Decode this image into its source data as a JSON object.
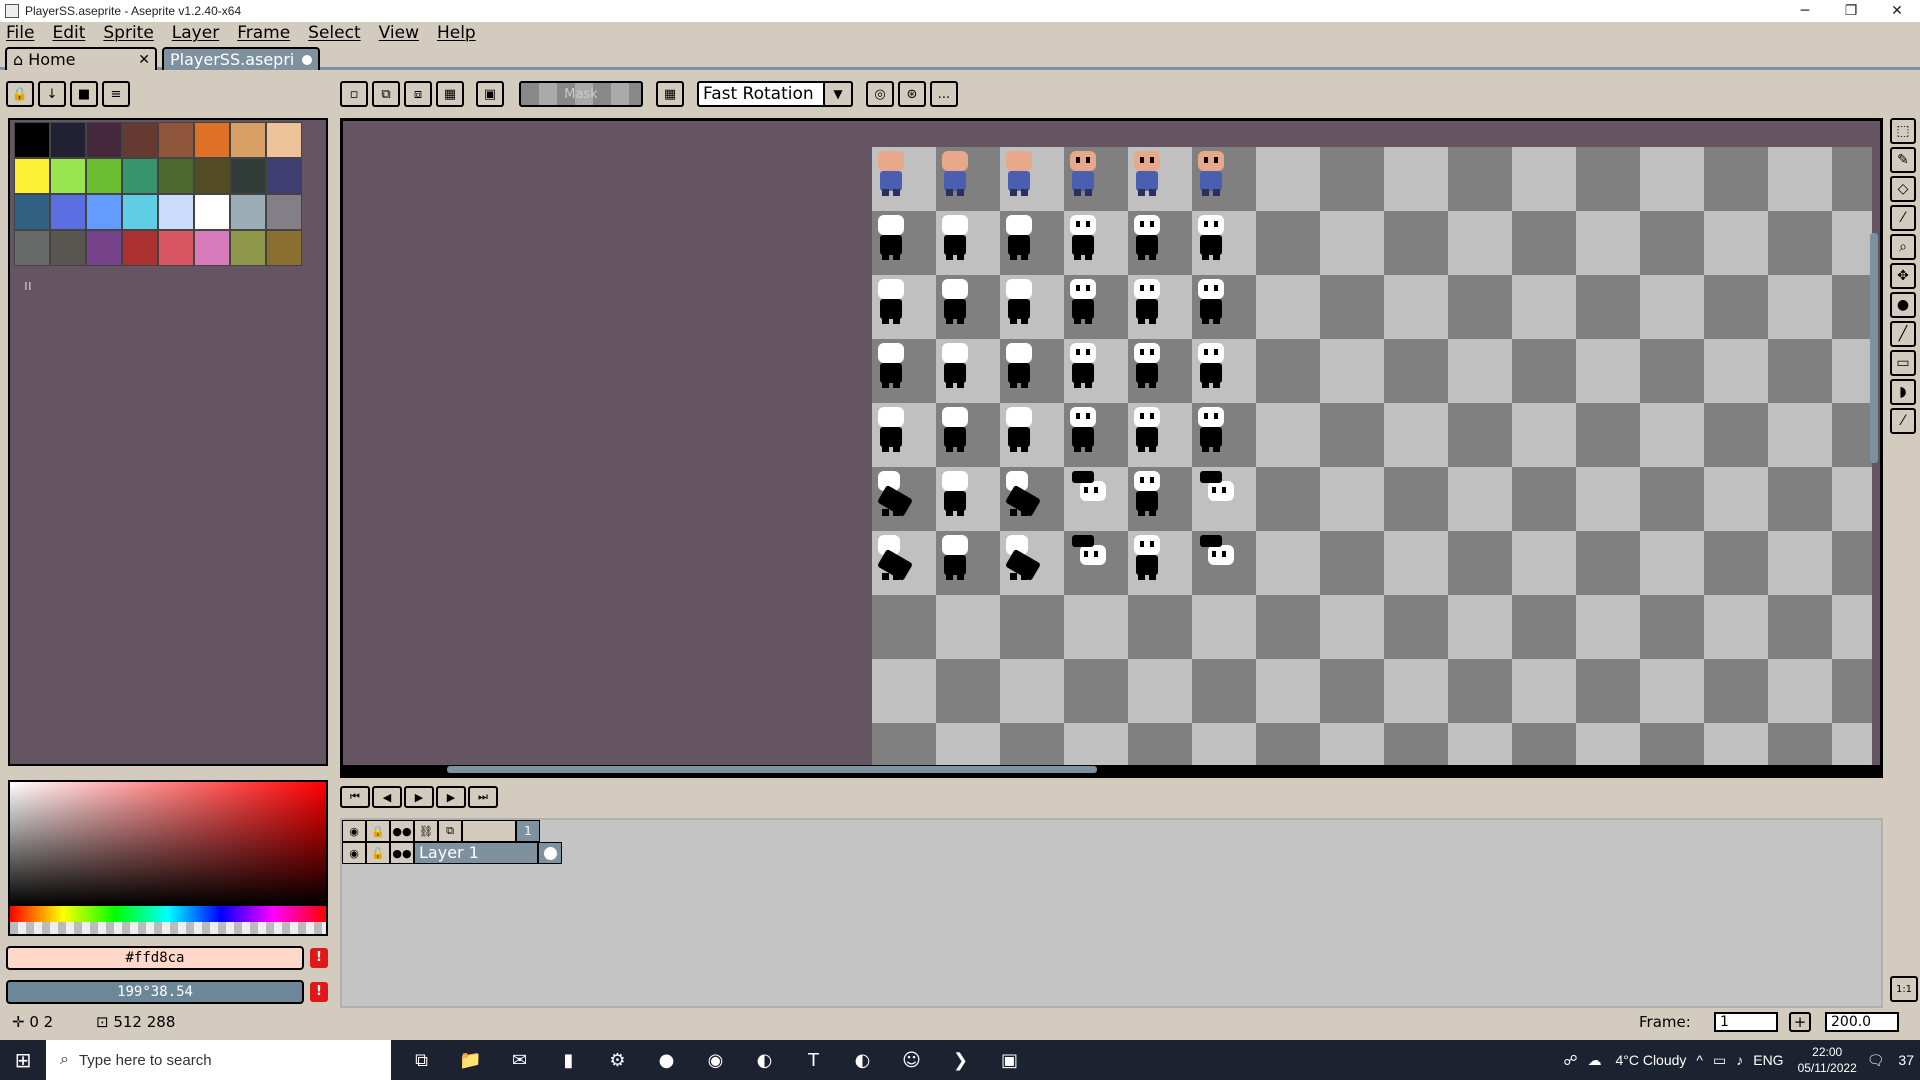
{
  "window": {
    "title": "PlayerSS.aseprite - Aseprite v1.2.40-x64",
    "minimize": "─",
    "restore": "❐",
    "close": "✕"
  },
  "menu": [
    "File",
    "Edit",
    "Sprite",
    "Layer",
    "Frame",
    "Select",
    "View",
    "Help"
  ],
  "tabs": {
    "home": "Home",
    "home_close": "✕",
    "active": "PlayerSS.asepri"
  },
  "toolbar": {
    "mask_label": "Mask",
    "rotation": "Fast Rotation",
    "more": "..."
  },
  "palette": {
    "colors": [
      "#000000",
      "#222034",
      "#45283c",
      "#663931",
      "#8f563b",
      "#df7126",
      "#d9a066",
      "#eec39a",
      "#fbf236",
      "#99e550",
      "#6abe30",
      "#37946e",
      "#4b692f",
      "#524b24",
      "#323c39",
      "#3f3f74",
      "#306082",
      "#5b6ee1",
      "#639bff",
      "#5fcde4",
      "#cbdbfc",
      "#ffffff",
      "#9badb7",
      "#847e87",
      "#696a6a",
      "#595652",
      "#76428a",
      "#ac3232",
      "#d95763",
      "#d77bba",
      "#8f974a",
      "#8a6f30"
    ],
    "mark": "ıı"
  },
  "color": {
    "fg_hex": "#ffd8ca",
    "fg_bg": "#ffd8ca",
    "bg_value": "199°38.54",
    "bg_bg": "#6c8797",
    "warn": "!"
  },
  "timeline": {
    "frame_header": "1",
    "layer_name": "Layer 1"
  },
  "status": {
    "cursor_pos": "0 2",
    "sprite_size": "512 288",
    "frame_label": "Frame:",
    "frame_value": "1",
    "frame_plus": "+",
    "zoom": "200.0"
  },
  "taskbar": {
    "search_placeholder": "Type here to search",
    "weather": "4°C  Cloudy",
    "lang": "ENG",
    "time": "22:00",
    "date": "05/11/2022",
    "notif": "37"
  },
  "sprites": {
    "rows": [
      [
        "color",
        "color",
        "color",
        "color-front",
        "color-front",
        "color-front"
      ],
      [
        "mask",
        "mask",
        "mask",
        "mask-front",
        "mask-front",
        "mask-front"
      ],
      [
        "mask",
        "mask",
        "mask",
        "mask-front",
        "mask-front",
        "mask-front"
      ],
      [
        "mask",
        "mask",
        "mask",
        "mask-front",
        "mask-front",
        "mask-front"
      ],
      [
        "mask",
        "mask",
        "mask",
        "mask-front",
        "mask-front",
        "mask-front"
      ],
      [
        "dash",
        "mask",
        "dash",
        "side",
        "mask-front",
        "side"
      ],
      [
        "dash",
        "mask",
        "dash",
        "side",
        "mask-front",
        "side"
      ]
    ]
  }
}
